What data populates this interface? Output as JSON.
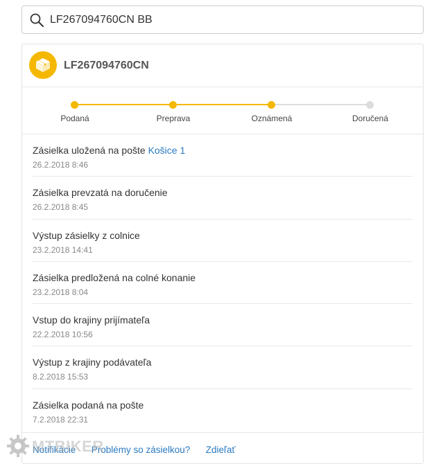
{
  "search": {
    "value": "LF267094760CN BB",
    "icon": "search-icon"
  },
  "shipment": {
    "tracking_number": "LF267094760CN",
    "icon": "package-icon",
    "accent_color": "#f5b800"
  },
  "progress": {
    "steps": [
      {
        "label": "Podaná",
        "done": true
      },
      {
        "label": "Preprava",
        "done": true
      },
      {
        "label": "Oznámená",
        "done": true
      },
      {
        "label": "Doručená",
        "done": false
      }
    ]
  },
  "events": [
    {
      "title": "Zásielka uložená na pošte",
      "link": "Košice 1",
      "time": "26.2.2018 8:46"
    },
    {
      "title": "Zásielka prevzatá na doručenie",
      "link": "",
      "time": "26.2.2018 8:45"
    },
    {
      "title": "Výstup zásielky z colnice",
      "link": "",
      "time": "23.2.2018 14:41"
    },
    {
      "title": "Zásielka predložená na colné konanie",
      "link": "",
      "time": "23.2.2018 8:04"
    },
    {
      "title": "Vstup do krajiny prijímateľa",
      "link": "",
      "time": "22.2.2018 10:56"
    },
    {
      "title": "Výstup z krajiny podávateľa",
      "link": "",
      "time": "8.2.2018 15:53"
    },
    {
      "title": "Zásielka podaná na pošte",
      "link": "",
      "time": "7.2.2018 22:31"
    }
  ],
  "footer": {
    "links": [
      "Notifikácie",
      "Problémy so zásielkou?",
      "Zdieľať"
    ],
    "link_color": "#2a7ac0"
  },
  "watermark": {
    "text": "MTBIKER",
    "icon": "gear-icon"
  }
}
